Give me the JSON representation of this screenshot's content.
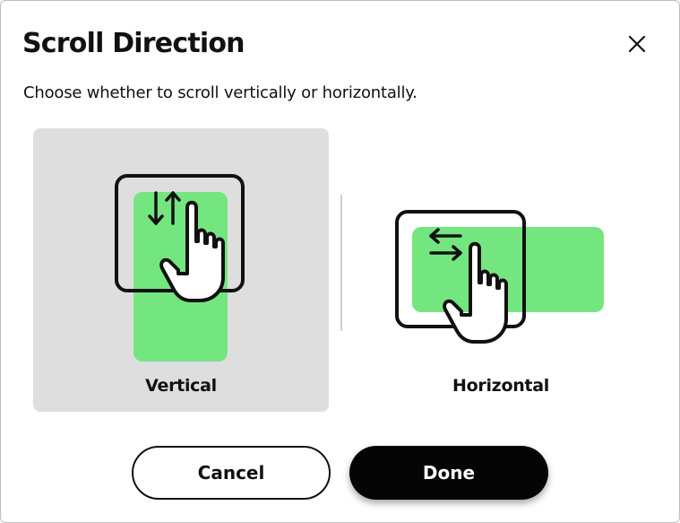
{
  "dialog": {
    "title": "Scroll Direction",
    "subtitle": "Choose whether to scroll vertically or horizontally.",
    "close_icon": "close-icon"
  },
  "options": [
    {
      "label": "Vertical",
      "selected": true,
      "icon": "vertical-scroll-gesture-icon"
    },
    {
      "label": "Horizontal",
      "selected": false,
      "icon": "horizontal-scroll-gesture-icon"
    }
  ],
  "buttons": {
    "cancel_label": "Cancel",
    "done_label": "Done"
  },
  "colors": {
    "selected_background": "#dedede",
    "accent_green": "#74e680",
    "primary_button": "#050505"
  }
}
